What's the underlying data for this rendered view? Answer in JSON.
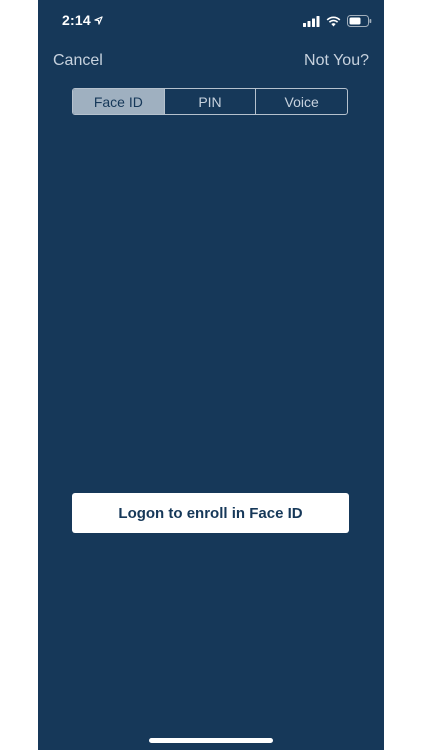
{
  "status_bar": {
    "time": "2:14",
    "location_icon": "location-arrow-icon",
    "signal_icon": "cellular-signal-icon",
    "wifi_icon": "wifi-icon",
    "battery_icon": "battery-icon"
  },
  "nav": {
    "cancel_label": "Cancel",
    "not_you_label": "Not You?"
  },
  "segments": [
    {
      "label": "Face ID",
      "active": true
    },
    {
      "label": "PIN",
      "active": false
    },
    {
      "label": "Voice",
      "active": false
    }
  ],
  "enroll_button_label": "Logon to enroll in Face ID",
  "colors": {
    "background": "#163859",
    "segment_active_bg": "#9fb0c0",
    "text_muted": "#c7d2de",
    "button_bg": "#ffffff",
    "button_text": "#163859"
  }
}
